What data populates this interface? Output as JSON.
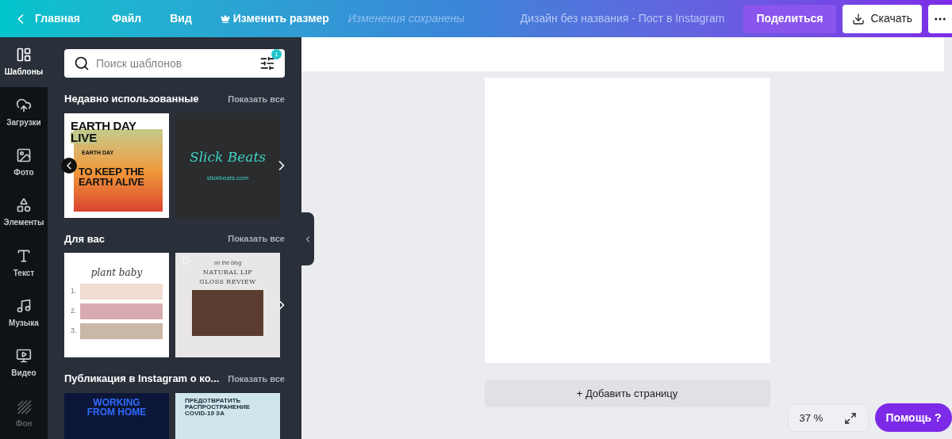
{
  "topbar": {
    "back": "Главная",
    "menus": [
      "Файл",
      "Вид"
    ],
    "resize": "Изменить размер",
    "save_status": "Изменения сохранены",
    "design_title": "Дизайн без названия - Пост в Instagram",
    "share": "Поделиться",
    "download": "Скачать"
  },
  "rail": [
    {
      "label": "Шаблоны",
      "selected": true,
      "disabled": false
    },
    {
      "label": "Загрузки",
      "selected": false,
      "disabled": false
    },
    {
      "label": "Фото",
      "selected": false,
      "disabled": false
    },
    {
      "label": "Элементы",
      "selected": false,
      "disabled": false
    },
    {
      "label": "Текст",
      "selected": false,
      "disabled": false
    },
    {
      "label": "Музыка",
      "selected": false,
      "disabled": false
    },
    {
      "label": "Видео",
      "selected": false,
      "disabled": false
    },
    {
      "label": "Фон",
      "selected": false,
      "disabled": true
    }
  ],
  "search": {
    "placeholder": "Поиск шаблонов",
    "filter_count": "1"
  },
  "sections": [
    {
      "title": "Недавно использованные",
      "show_all": "Показать все",
      "prev": true,
      "templates": [
        {
          "kind": "earth",
          "lines": [
            "EARTH DAY",
            "LIVE",
            "TO KEEP THE",
            "EARTH ALIVE"
          ],
          "badge": "EARTH DAY"
        },
        {
          "kind": "beats",
          "lines": [
            "Slick Beats",
            "slickbeats.com"
          ]
        }
      ]
    },
    {
      "title": "Для вас",
      "show_all": "Показать все",
      "prev": false,
      "templates": [
        {
          "kind": "plant",
          "lines": [
            "plant baby",
            "1.",
            "2.",
            "3."
          ]
        },
        {
          "kind": "gloss",
          "lines": [
            "on the blog",
            "NATURAL LIP",
            "GLOSS REVIEW"
          ]
        }
      ]
    },
    {
      "title": "Публикация в Instagram о ко...",
      "show_all": "Показать все",
      "prev": false,
      "templates": [
        {
          "kind": "work",
          "lines": [
            "WORKING",
            "FROM HOME"
          ]
        },
        {
          "kind": "covid",
          "lines": [
            "ПРЕДОТВРАТИТЬ",
            "РАСПРОСТРАНЕНИЕ",
            "COVID-19 ЗА"
          ]
        }
      ]
    }
  ],
  "add_page": "+ Добавить страницу",
  "zoom": "37 %",
  "help": "Помощь ?"
}
